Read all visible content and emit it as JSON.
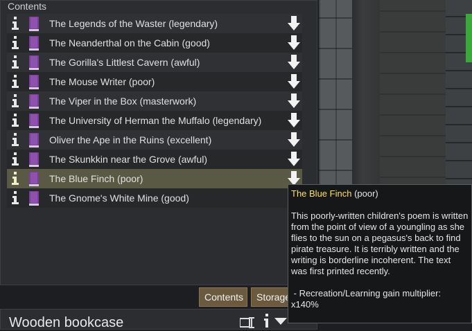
{
  "panel": {
    "title": "Contents"
  },
  "items": [
    {
      "label": "The Legends of the Waster (legendary)"
    },
    {
      "label": "The Neanderthal on the Cabin (good)"
    },
    {
      "label": "The Gorilla's Littlest Cavern (awful)"
    },
    {
      "label": "The Mouse Writer (poor)"
    },
    {
      "label": "The Viper in the Box (masterwork)"
    },
    {
      "label": "The University of Herman the Muffalo (legendary)"
    },
    {
      "label": "Oliver the Ape in the Ruins (excellent)"
    },
    {
      "label": "The Skunkkin near the Grove (awful)"
    },
    {
      "label": "The Blue Finch (poor)"
    },
    {
      "label": "The Gnome's White Mine (good)"
    }
  ],
  "tabs": {
    "contents": "Contents",
    "storage": "Storage"
  },
  "inspect": {
    "title": "Wooden bookcase"
  },
  "tooltip": {
    "name": "The Blue Finch",
    "quality": "(poor)",
    "description": "This poorly-written children's poem is written from the point of view of a youngling as she flies to the sun on a pegasus's back to find pirate treasure. It is terribly written and the writing is borderline incoherent. The text was first printed recently.",
    "stat": " - Recreation/Learning gain multiplier: x140%"
  },
  "icons": {
    "info": "info-icon",
    "book": "book-icon",
    "drop": "drop-down-arrow-icon"
  },
  "colors": {
    "highlight_row": "#5a5a44",
    "book": "#8a4fa8",
    "tooltip_name": "#ffe05a",
    "tab": "#6b5a3e"
  }
}
